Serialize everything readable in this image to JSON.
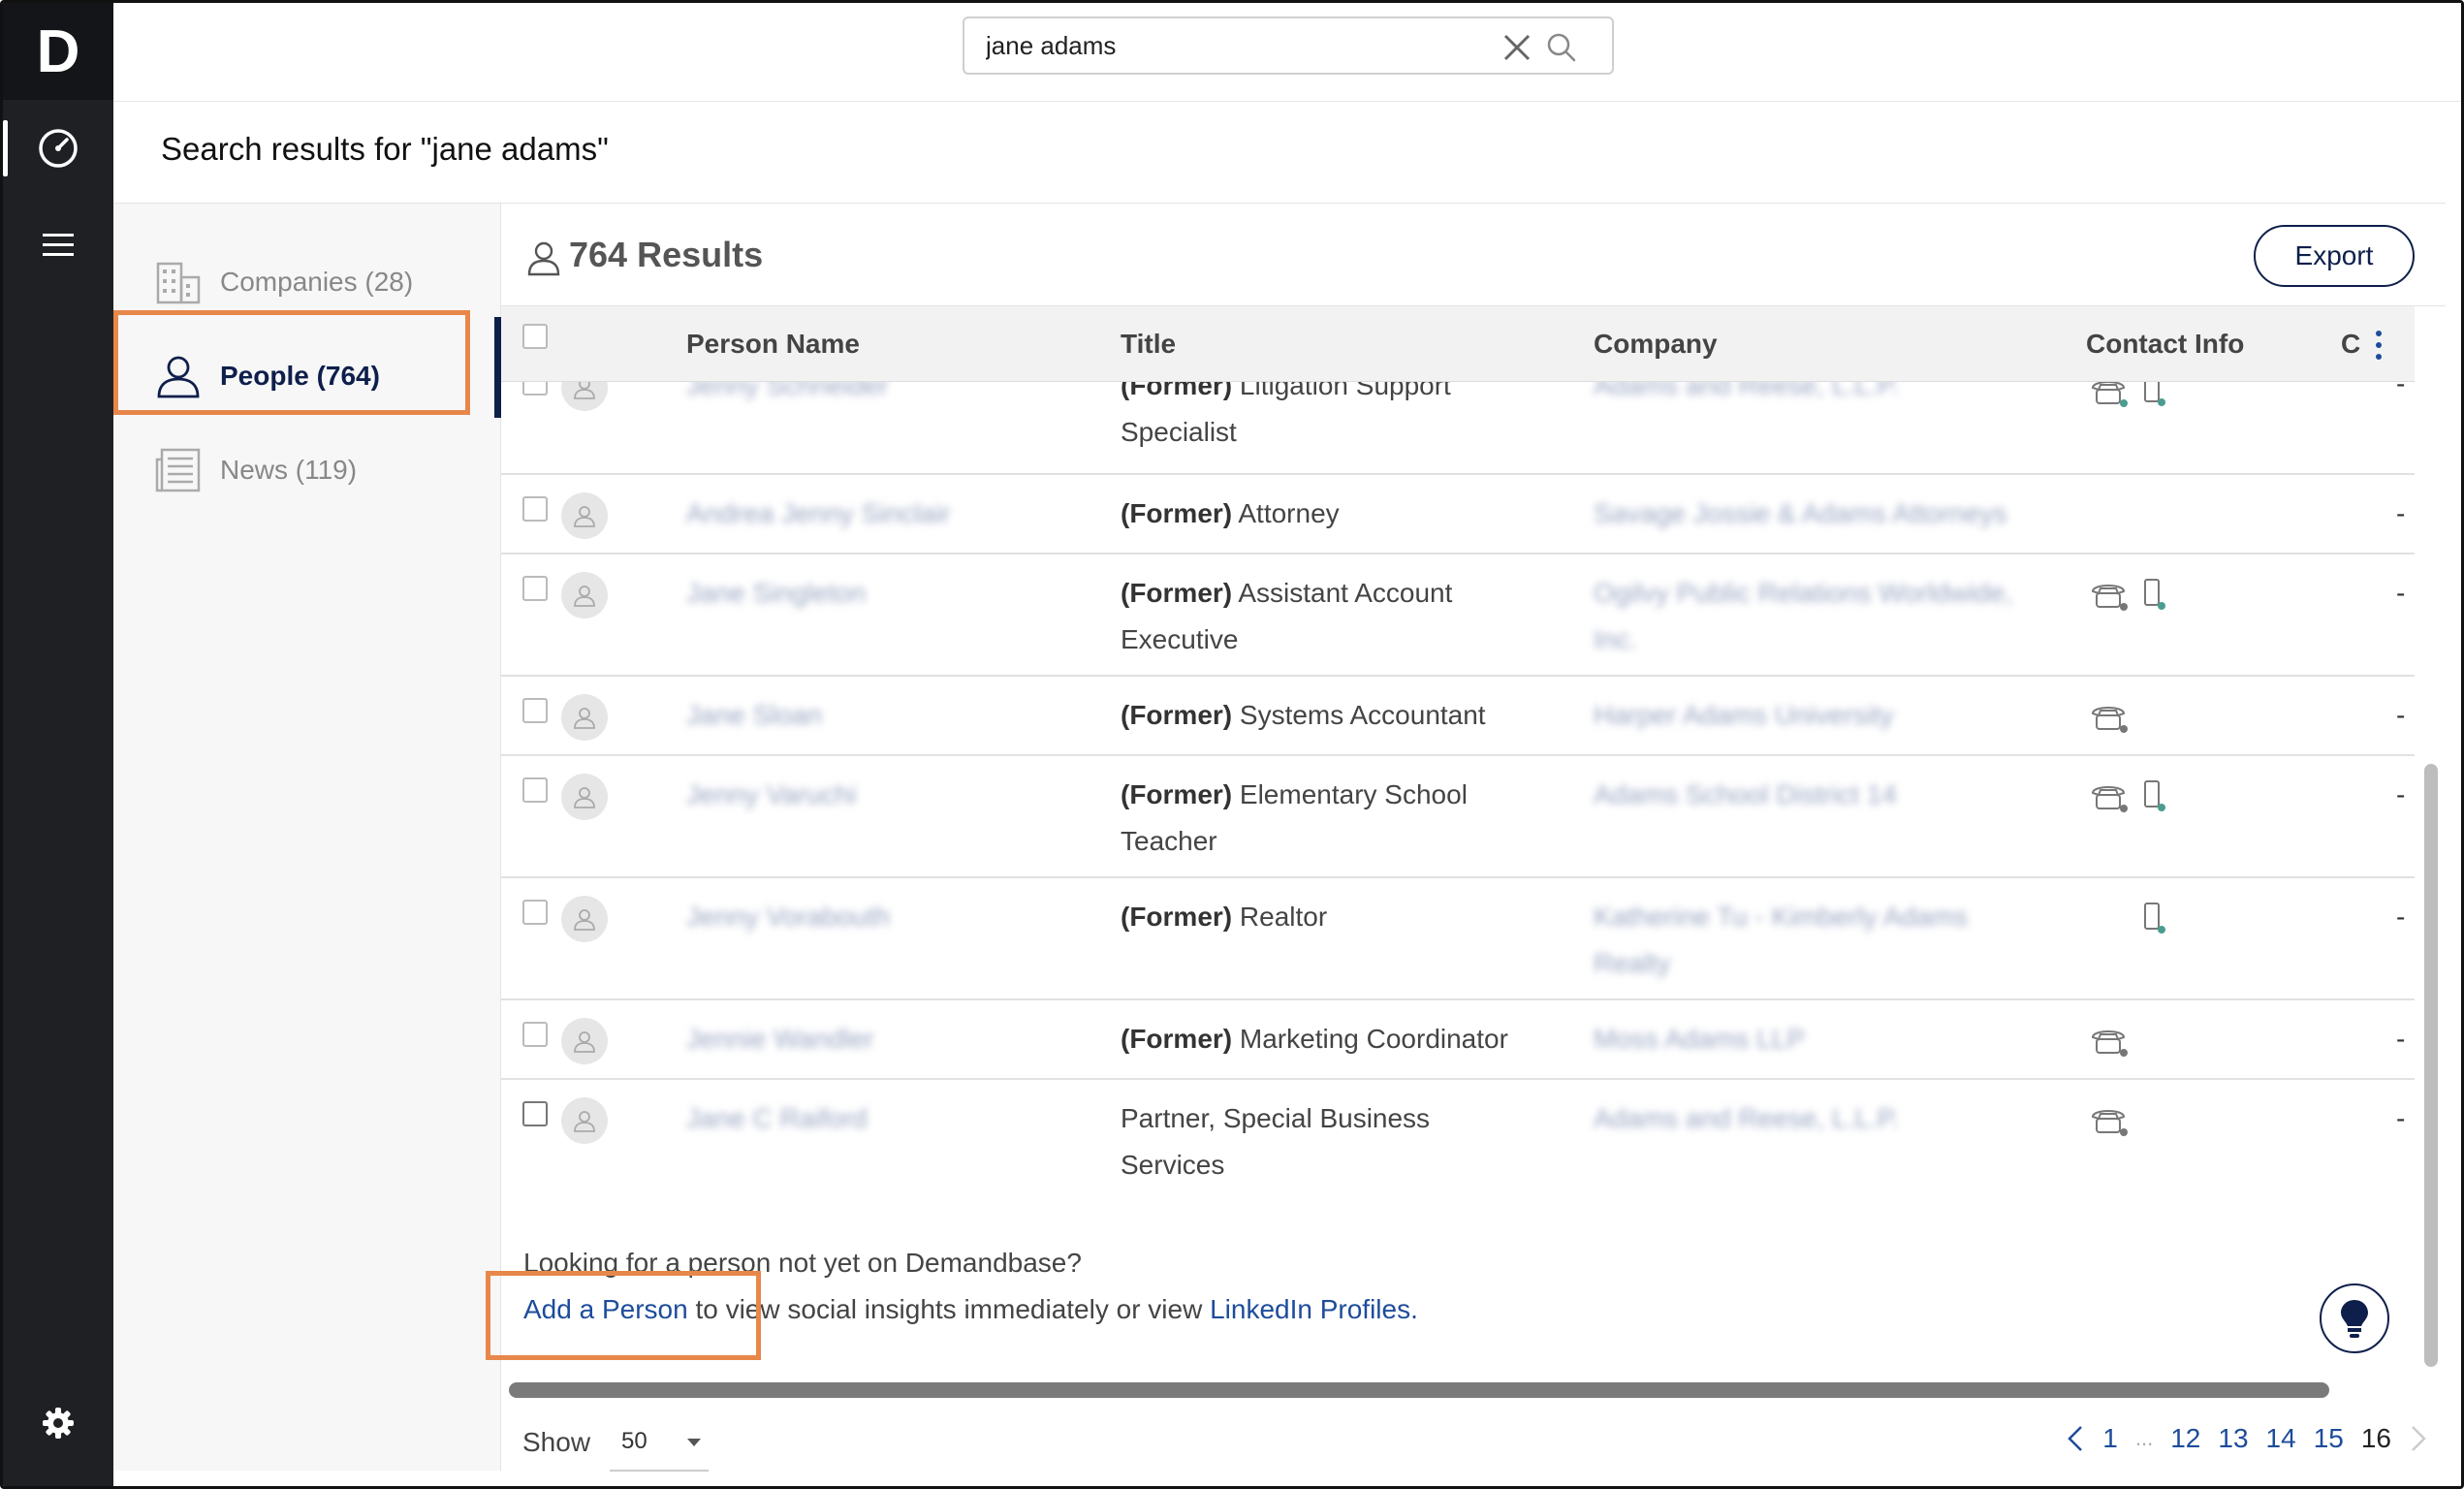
{
  "app": {
    "logo_letter": "D"
  },
  "search": {
    "value": "jane adams",
    "placeholder": ""
  },
  "page": {
    "heading": "Search results for \"jane adams\""
  },
  "sidebar": {
    "items": [
      {
        "label": "Companies (28)",
        "icon": "building-icon"
      },
      {
        "label": "People (764)",
        "icon": "person-icon"
      },
      {
        "label": "News (119)",
        "icon": "newspaper-icon"
      }
    ]
  },
  "results": {
    "title": "764 Results",
    "export_label": "Export",
    "columns": [
      "Person Name",
      "Title",
      "Company",
      "Contact Info",
      "C"
    ],
    "rows": [
      {
        "name": "Jenny Schneider",
        "former": "(Former)",
        "title_line1": "Litigation Support",
        "title_line2": "Specialist",
        "company_line1": "Adams and Reese, L.L.P.",
        "company_line2": "",
        "dash": "-"
      },
      {
        "name": "Andrea Jenny Sinclair",
        "former": "(Former)",
        "title_line1": "Attorney",
        "title_line2": "",
        "company_line1": "Savage Jossie & Adams Attorneys",
        "company_line2": "",
        "dash": "-"
      },
      {
        "name": "Jane Singleton",
        "former": "(Former)",
        "title_line1": "Assistant Account",
        "title_line2": "Executive",
        "company_line1": "Ogilvy Public Relations Worldwide,",
        "company_line2": "Inc.",
        "dash": "-"
      },
      {
        "name": "Jane Sloan",
        "former": "(Former)",
        "title_line1": "Systems Accountant",
        "title_line2": "",
        "company_line1": "Harper Adams University",
        "company_line2": "",
        "dash": "-"
      },
      {
        "name": "Jenny Varuchi",
        "former": "(Former)",
        "title_line1": "Elementary School",
        "title_line2": "Teacher",
        "company_line1": "Adams School District 14",
        "company_line2": "",
        "dash": "-"
      },
      {
        "name": "Jenny Vorabouth",
        "former": "(Former)",
        "title_line1": "Realtor",
        "title_line2": "",
        "company_line1": "Katherine Tu - Kimberly Adams",
        "company_line2": "Realty",
        "dash": "-"
      },
      {
        "name": "Jennie Wandler",
        "former": "(Former)",
        "title_line1": "Marketing Coordinator",
        "title_line2": "",
        "company_line1": "Moss Adams LLP",
        "company_line2": "",
        "dash": "-"
      },
      {
        "name": "Jane C Raiford",
        "former": "",
        "title_line1": "Partner, Special Business",
        "title_line2": "Services",
        "company_line1": "Adams and Reese, L.L.P.",
        "company_line2": "",
        "dash": "-"
      }
    ]
  },
  "footer": {
    "line1": "Looking for a person not yet on Demandbase?",
    "add_link": "Add a Person",
    "middle": " to view social insights immediately or view ",
    "linkedin_link": "LinkedIn Profiles",
    "end": "."
  },
  "pagination": {
    "show_label": "Show",
    "page_size": "50",
    "pages": [
      "1",
      "...",
      "12",
      "13",
      "14",
      "15",
      "16"
    ],
    "current": "16"
  },
  "colors": {
    "accent": "#0e1f4b",
    "highlight": "#e8874a",
    "link": "#1d4c9b",
    "rail": "#1f2024"
  }
}
